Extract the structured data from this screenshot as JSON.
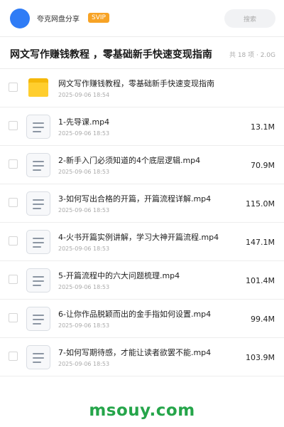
{
  "header": {
    "user_name": "夸克网盘分享",
    "vip_badge": "SVIP",
    "search_placeholder": "搜索"
  },
  "share": {
    "title": "网文写作赚钱教程 ，零基础新手快速变现指南",
    "meta": "共 18 项 · 2.0G"
  },
  "files": [
    {
      "name": "网文写作赚钱教程，零基础新手快速变现指南",
      "time": "2025-09-06 18:54",
      "size": "",
      "icon": "folder-icon"
    },
    {
      "name": "1-先导课.mp4",
      "time": "2025-09-06 18:53",
      "size": "13.1M",
      "icon": "document-icon"
    },
    {
      "name": "2-新手入门必须知道的4个底层逻辑.mp4",
      "time": "2025-09-06 18:53",
      "size": "70.9M",
      "icon": "document-icon"
    },
    {
      "name": "3-如何写出合格的开篇，开篇流程详解.mp4",
      "time": "2025-09-06 18:53",
      "size": "115.0M",
      "icon": "document-icon"
    },
    {
      "name": "4-火书开篇实例讲解，学习大神开篇流程.mp4",
      "time": "2025-09-06 18:53",
      "size": "147.1M",
      "icon": "document-icon"
    },
    {
      "name": "5-开篇流程中的六大问题梳理.mp4",
      "time": "2025-09-06 18:53",
      "size": "101.4M",
      "icon": "document-icon"
    },
    {
      "name": "6-让你作品脱颖而出的金手指如何设置.mp4",
      "time": "2025-09-06 18:53",
      "size": "99.4M",
      "icon": "document-icon"
    },
    {
      "name": "7-如何写期待感，才能让读者欲罢不能.mp4",
      "time": "2025-09-06 18:53",
      "size": "103.9M",
      "icon": "document-icon"
    }
  ],
  "footer": {
    "domain": "msouy.com"
  },
  "colors": {
    "avatar": "#2f7cf6",
    "vip": "#f7a325",
    "folder": "#ffce2e",
    "footer_text": "#25a54a"
  }
}
